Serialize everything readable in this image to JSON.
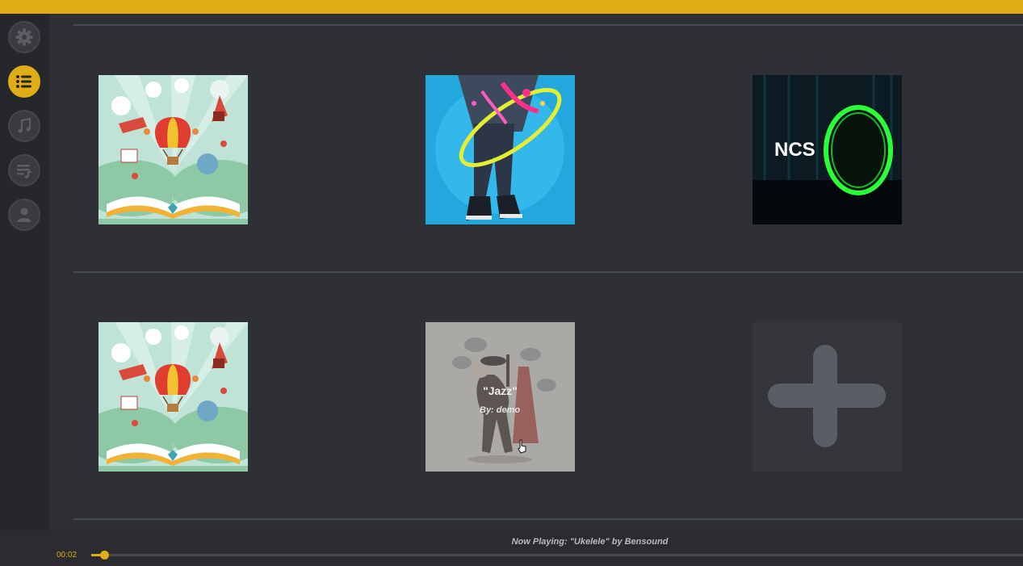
{
  "colors": {
    "accent": "#e1ad17",
    "background": "#2f3035",
    "sidebar": "#26272b"
  },
  "sidebar": {
    "items": [
      {
        "icon": "gear-icon",
        "active": false
      },
      {
        "icon": "list-icon",
        "active": true
      },
      {
        "icon": "music-note-icon",
        "active": false
      },
      {
        "icon": "playlist-icon",
        "active": false
      },
      {
        "icon": "user-icon",
        "active": false
      }
    ]
  },
  "tiles": [
    {
      "art": "storybook"
    },
    {
      "art": "dancer"
    },
    {
      "art": "ncs",
      "label": "NCS"
    },
    {
      "art": "storybook"
    },
    {
      "art": "jazz",
      "title": "\"Jazz\"",
      "by": "By: demo"
    },
    {
      "art": "add",
      "icon": "plus-icon"
    }
  ],
  "player": {
    "now_playing": "Now Playing: \"Ukelele\" by Bensound",
    "time": "00:02",
    "progress_fraction": 0.014
  }
}
